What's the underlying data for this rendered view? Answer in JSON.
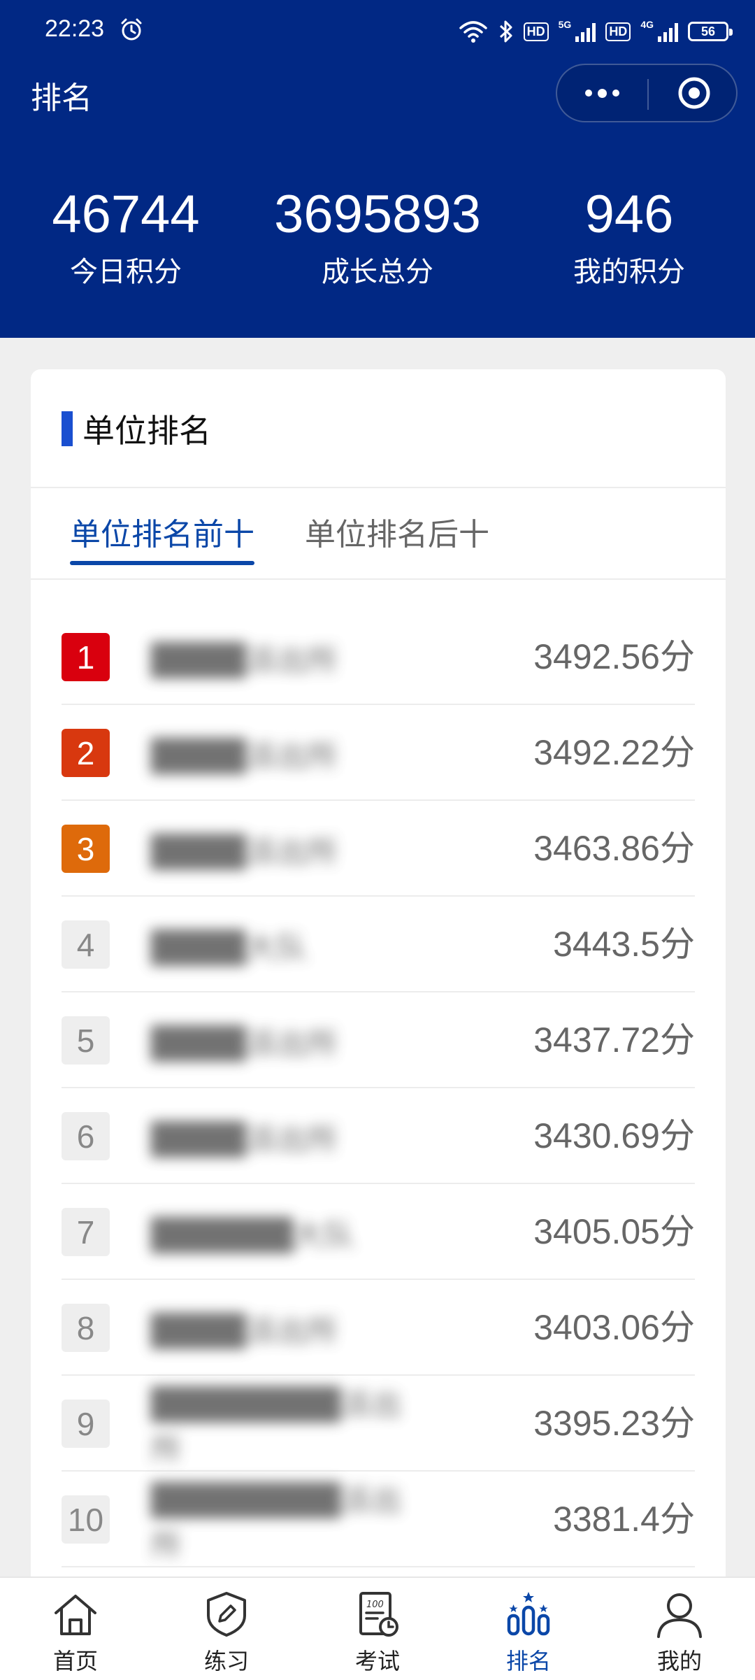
{
  "status_bar": {
    "time": "22:23",
    "battery": "56",
    "network_1": "5G",
    "network_2": "4G",
    "hd_label": "HD",
    "icons": [
      "alarm-icon",
      "wifi-icon",
      "bluetooth-icon",
      "signal-icon",
      "battery-icon"
    ]
  },
  "header": {
    "title": "排名",
    "stats": [
      {
        "value": "46744",
        "label": "今日积分"
      },
      {
        "value": "3695893",
        "label": "成长总分"
      },
      {
        "value": "946",
        "label": "我的积分"
      }
    ],
    "colors": {
      "background": "#012884"
    }
  },
  "card": {
    "title": "单位排名",
    "tabs": [
      {
        "label": "单位排名前十",
        "active": true
      },
      {
        "label": "单位排名后十",
        "active": false
      }
    ],
    "rows": [
      {
        "rank": "1",
        "name": "████派出所",
        "score": "3492.56分"
      },
      {
        "rank": "2",
        "name": "████派出所",
        "score": "3492.22分"
      },
      {
        "rank": "3",
        "name": "████派出所",
        "score": "3463.86分"
      },
      {
        "rank": "4",
        "name": "████大队",
        "score": "3443.5分"
      },
      {
        "rank": "5",
        "name": "████派出所",
        "score": "3437.72分"
      },
      {
        "rank": "6",
        "name": "████派出所",
        "score": "3430.69分"
      },
      {
        "rank": "7",
        "name": "██████大队",
        "score": "3405.05分"
      },
      {
        "rank": "8",
        "name": "████派出所",
        "score": "3403.06分"
      },
      {
        "rank": "9",
        "name": "████████派出所",
        "score": "3395.23分"
      },
      {
        "rank": "10",
        "name": "████████派出所",
        "score": "3381.4分"
      }
    ],
    "rank_colors": {
      "1": "#d9000e",
      "2": "#d8380f",
      "3": "#de6a0b"
    }
  },
  "tabbar": {
    "items": [
      {
        "label": "首页",
        "icon": "home-icon",
        "active": false
      },
      {
        "label": "练习",
        "icon": "practice-icon",
        "active": false
      },
      {
        "label": "考试",
        "icon": "exam-icon",
        "active": false
      },
      {
        "label": "排名",
        "icon": "ranking-icon",
        "active": true
      },
      {
        "label": "我的",
        "icon": "profile-icon",
        "active": false
      }
    ],
    "active_color": "#0b47a8"
  }
}
